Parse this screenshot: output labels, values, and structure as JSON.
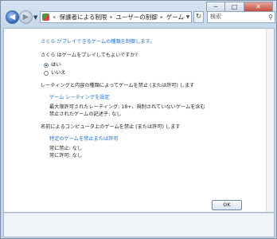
{
  "window": {
    "caption": {
      "minimize": "─",
      "maximize": "□",
      "close": "✕"
    }
  },
  "nav": {
    "back_glyph": "◀",
    "forward_glyph": "▶",
    "recent_glyph": "▼",
    "address": {
      "crumbs": [
        "保護者による制限",
        "ユーザーの制御",
        "ゲームの制御"
      ],
      "more": "«",
      "separator": "▸",
      "drop_glyph": "▼"
    },
    "refresh_glyph": "↻",
    "search_placeholder": "検索",
    "search_glyph": "⚲"
  },
  "content": {
    "title_link": "さくら がプレイできるゲームの種類を制御します。",
    "question": "さくら はゲームをプレイしてもよいですか?",
    "options": [
      {
        "label": "はい",
        "selected": true
      },
      {
        "label": "いいえ",
        "selected": false
      }
    ],
    "rating_heading": "レーティングと内容の種類によってゲームを禁止 (または許可) します",
    "rating_link": "ゲーム レーティングを設定",
    "max_rating": "最大限許可されたレーティング: 18+、規制されていないゲームを含む",
    "blocked_content": "禁止されたゲームの記述子: なし",
    "name_heading": "名前によるコンピュータ上のゲームを禁止 (または許可) します",
    "name_link": "特定のゲームを禁止または許可",
    "always_block": "常に禁止: なし",
    "always_allow": "常に許可: なし"
  },
  "footer": {
    "ok_label": "OK"
  }
}
